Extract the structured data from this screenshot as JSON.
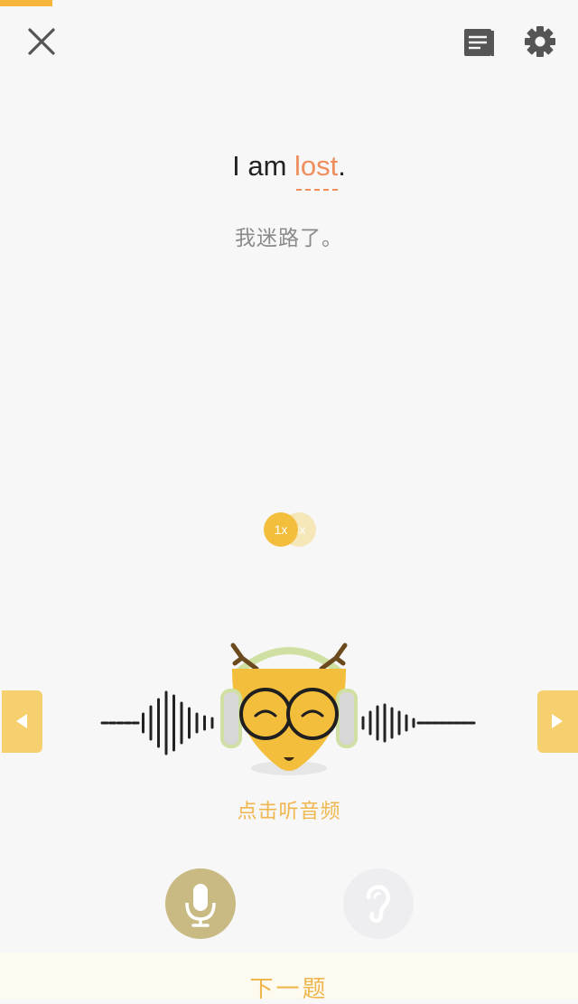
{
  "progress": {
    "fraction": 0.09
  },
  "icons": {
    "close": "close-icon",
    "notes": "notes-icon",
    "settings": "gear-icon",
    "prev": "triangle-left-icon",
    "next": "triangle-right-icon",
    "mic": "microphone-icon",
    "ear": "ear-icon"
  },
  "sentence": {
    "before": "I am ",
    "highlight": "lost",
    "after": "."
  },
  "translation": "我迷路了。",
  "speed": {
    "current": "1x",
    "alternate": "3x"
  },
  "player": {
    "hint": "点击听音频"
  },
  "footer": {
    "next_label": "下一题"
  },
  "colors": {
    "accent": "#f3be3c",
    "highlight_word": "#ef8d5c",
    "hint_text": "#f0b64e",
    "mic_button": "#c9b982"
  }
}
